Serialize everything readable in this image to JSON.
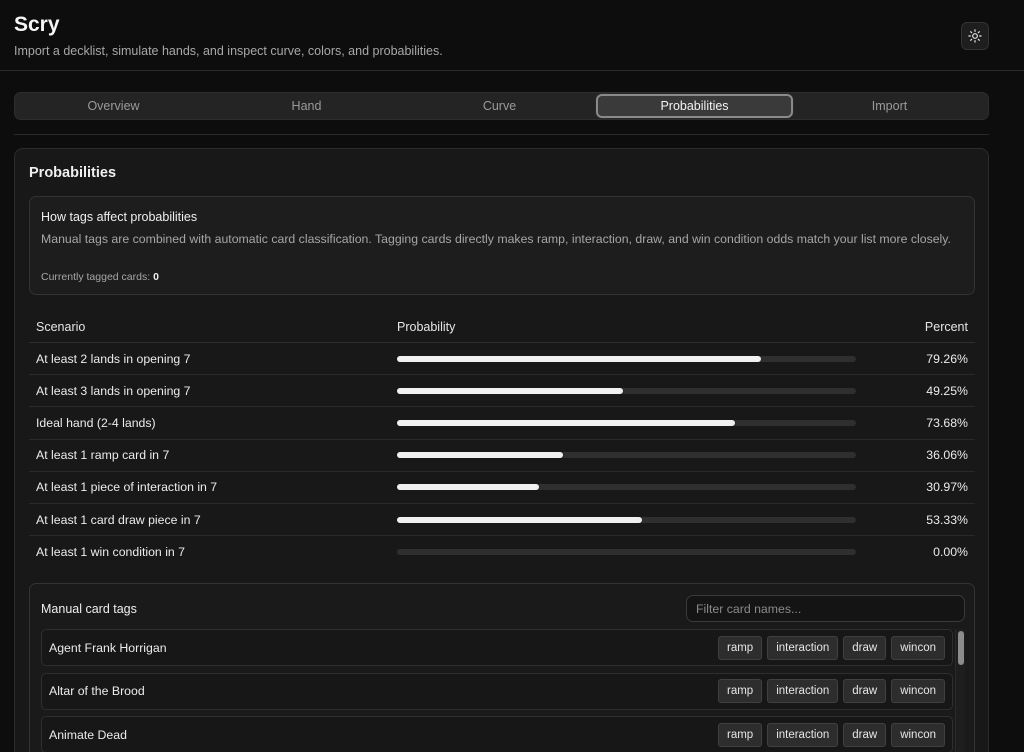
{
  "app": {
    "title": "Scry",
    "subtitle": "Import a decklist, simulate hands, and inspect curve, colors, and probabilities.",
    "theme_icon": "sun-icon"
  },
  "tabs": [
    {
      "label": "Overview",
      "active": false
    },
    {
      "label": "Hand",
      "active": false
    },
    {
      "label": "Curve",
      "active": false
    },
    {
      "label": "Probabilities",
      "active": true
    },
    {
      "label": "Import",
      "active": false
    }
  ],
  "panel": {
    "title": "Probabilities",
    "info": {
      "heading": "How tags affect probabilities",
      "text": "Manual tags are combined with automatic card classification. Tagging cards directly makes ramp, interaction, draw, and win condition odds match your list more closely.",
      "tagged_label": "Currently tagged cards:",
      "tagged_count": "0"
    },
    "table": {
      "headers": {
        "scenario": "Scenario",
        "probability": "Probability",
        "percent": "Percent"
      },
      "rows": [
        {
          "scenario": "At least 2 lands in opening 7",
          "value": 0.7926,
          "percent": "79.26%"
        },
        {
          "scenario": "At least 3 lands in opening 7",
          "value": 0.4925,
          "percent": "49.25%"
        },
        {
          "scenario": "Ideal hand (2-4 lands)",
          "value": 0.7368,
          "percent": "73.68%"
        },
        {
          "scenario": "At least 1 ramp card in 7",
          "value": 0.3606,
          "percent": "36.06%"
        },
        {
          "scenario": "At least 1 piece of interaction in 7",
          "value": 0.3097,
          "percent": "30.97%"
        },
        {
          "scenario": "At least 1 card draw piece in 7",
          "value": 0.5333,
          "percent": "53.33%"
        },
        {
          "scenario": "At least 1 win condition in 7",
          "value": 0.0,
          "percent": "0.00%"
        }
      ]
    },
    "manual_tags": {
      "title": "Manual card tags",
      "filter_placeholder": "Filter card names...",
      "filter_value": "",
      "tag_labels": [
        "ramp",
        "interaction",
        "draw",
        "wincon"
      ],
      "cards": [
        {
          "name": "Agent Frank Horrigan"
        },
        {
          "name": "Altar of the Brood"
        },
        {
          "name": "Animate Dead"
        }
      ]
    }
  }
}
